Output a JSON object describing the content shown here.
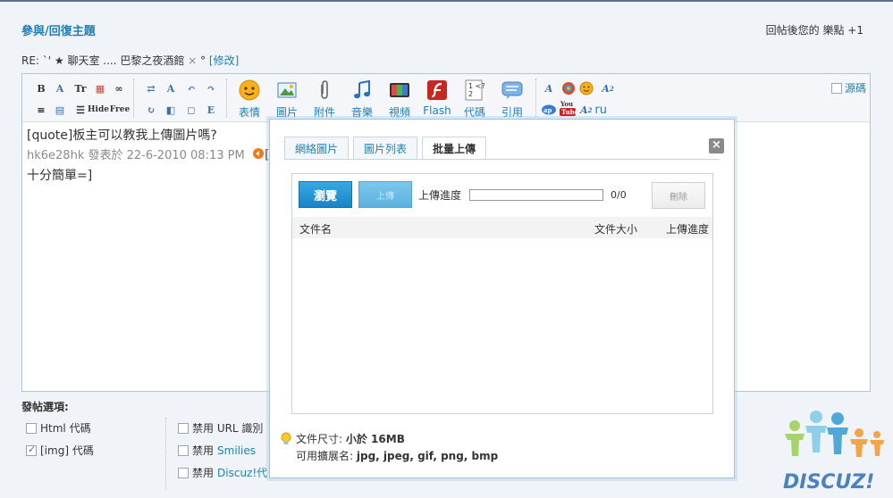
{
  "page": {
    "title": "參與/回復主題",
    "reward_note": "回帖後您的 樂點 +1"
  },
  "subject": {
    "prefix": "RE: `' ★ 聊天室 .... 巴黎之夜酒館",
    "remove": "×",
    "suffix": "°",
    "edit_link": "[修改]"
  },
  "toolbar": {
    "small_row1": [
      "B",
      "A",
      "Tr",
      "▦",
      "∞",
      "⇄",
      "A",
      "↶",
      "↷"
    ],
    "small_row2": [
      "≡",
      "▤",
      "☰",
      "Hide",
      "Free",
      "↻",
      "◧",
      "◻",
      "E"
    ],
    "buttons": [
      {
        "icon": "emoticon-icon",
        "label": "表情"
      },
      {
        "icon": "image-icon",
        "label": "圖片"
      },
      {
        "icon": "attachment-icon",
        "label": "附件"
      },
      {
        "icon": "music-icon",
        "label": "音樂"
      },
      {
        "icon": "video-icon",
        "label": "視頻"
      },
      {
        "icon": "flash-icon",
        "label": "Flash"
      },
      {
        "icon": "code-icon",
        "label": "代碼"
      },
      {
        "icon": "quote-icon",
        "label": "引用"
      }
    ],
    "extra_row2_label": "ru",
    "source_label": "源碼"
  },
  "editor": {
    "line1": "[quote]板主可以教我上傳圖片嗎?",
    "line2_meta": "hk6e28hk 發表於 22-6-2010 08:13 PM",
    "line2_tail": "[",
    "line3": "十分簡單=]"
  },
  "options": {
    "title": "發帖選項:",
    "html_label": "Html 代碼",
    "img_label": "[img] 代碼",
    "url_label": "禁用 URL 識別",
    "smilies_prefix": "禁用",
    "smilies_link": "Smilies",
    "discuz_prefix": "禁用",
    "discuz_link": "Discuz!代"
  },
  "dialog": {
    "tabs": [
      "網絡圖片",
      "圖片列表",
      "批量上傳"
    ],
    "active_tab": 2,
    "close": "×",
    "browse_label": "瀏覽",
    "upload_label": "上傳",
    "progress_label": "上傳進度",
    "progress_value": 0,
    "progress_count": "0/0",
    "delete_label": "刪除",
    "columns": {
      "name": "文件名",
      "size": "文件大小",
      "progress": "上傳進度"
    },
    "hint_size_label": "文件尺寸:",
    "hint_size_value": "小於 16MB",
    "hint_ext_label": "可用擴展名:",
    "hint_ext_value": "jpg, jpeg, gif, png, bmp"
  },
  "logo": {
    "text": "DISCUZ!"
  },
  "colors": {
    "link": "#1f7fb6",
    "browse": "#1a84c6",
    "dialog_border": "#9cc5de",
    "background": "#f0f3f8"
  }
}
